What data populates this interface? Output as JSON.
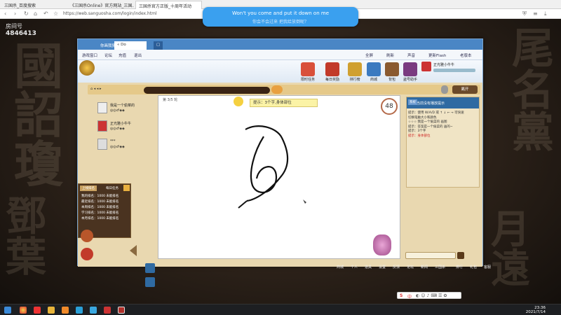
{
  "browser": {
    "tabs": [
      "三国杀_百度搜索",
      "《三国杀Online》官方网站_三国...",
      "三国杀官方正版_十周年活动"
    ],
    "url": "https://web.sanguosha.com/login/index.html"
  },
  "notification": {
    "title": "Won't you come and put it down on me",
    "subtitle": "你会不会过来 把我给放倒呢？"
  },
  "room": {
    "label": "房间号",
    "number": "4846413"
  },
  "app": {
    "tabs": [
      "你画我猜",
      "« Do"
    ],
    "menu": [
      "游戏窗口",
      "论坛",
      "充值",
      "退出"
    ],
    "toolbar": [
      "全屏",
      "刷新",
      "声音",
      "更新Flash",
      "老版本"
    ],
    "header_icons": [
      "限时任务",
      "每日奖励",
      "排行榜",
      "商城",
      "背包",
      "盗号助手"
    ],
    "user_tag": "正光雅小牛牛"
  },
  "game": {
    "round": "第 3/5 轮",
    "timer": "48",
    "hint": "提示：3个字,身体部位",
    "leave_button": "离开",
    "players": [
      {
        "name": "我是一个偷菜的",
        "score": "0"
      },
      {
        "name": "正光雅小牛牛",
        "score": "0"
      },
      {
        "name": "***",
        "score": "0"
      }
    ],
    "right_panel": {
      "title": "当前没有播放提示",
      "tag": "系统",
      "lines": [
        "提示：使用 W/A/D 或 ↑ ↓ ← → 可快速",
        "切换笔触大小和颜色",
        "☆☆☆ 我是一个偷菜的 画图",
        "提示：答案是一个偷菜的 画的~",
        "提示：3个字",
        "提示：身体部位"
      ]
    },
    "ranks_tabs": [
      "上线排名",
      "每日任务"
    ],
    "ranks": [
      "我的排名：1000 未能排名",
      "最近排名：1000 未能排名",
      "本周排名：1000 未能排名",
      "学习排名：1000 未能排名",
      "本月排名：1000 未能排名"
    ]
  },
  "bottom_menu": [
    "商城",
    "个人",
    "道具",
    "设置",
    "反馈",
    "论坛",
    "新闻",
    "三国杀",
    "排行",
    "礼包",
    "客服"
  ],
  "ime": {
    "label": "中"
  },
  "taskbar": {
    "time": "23:36",
    "date": "2021/7/14"
  }
}
